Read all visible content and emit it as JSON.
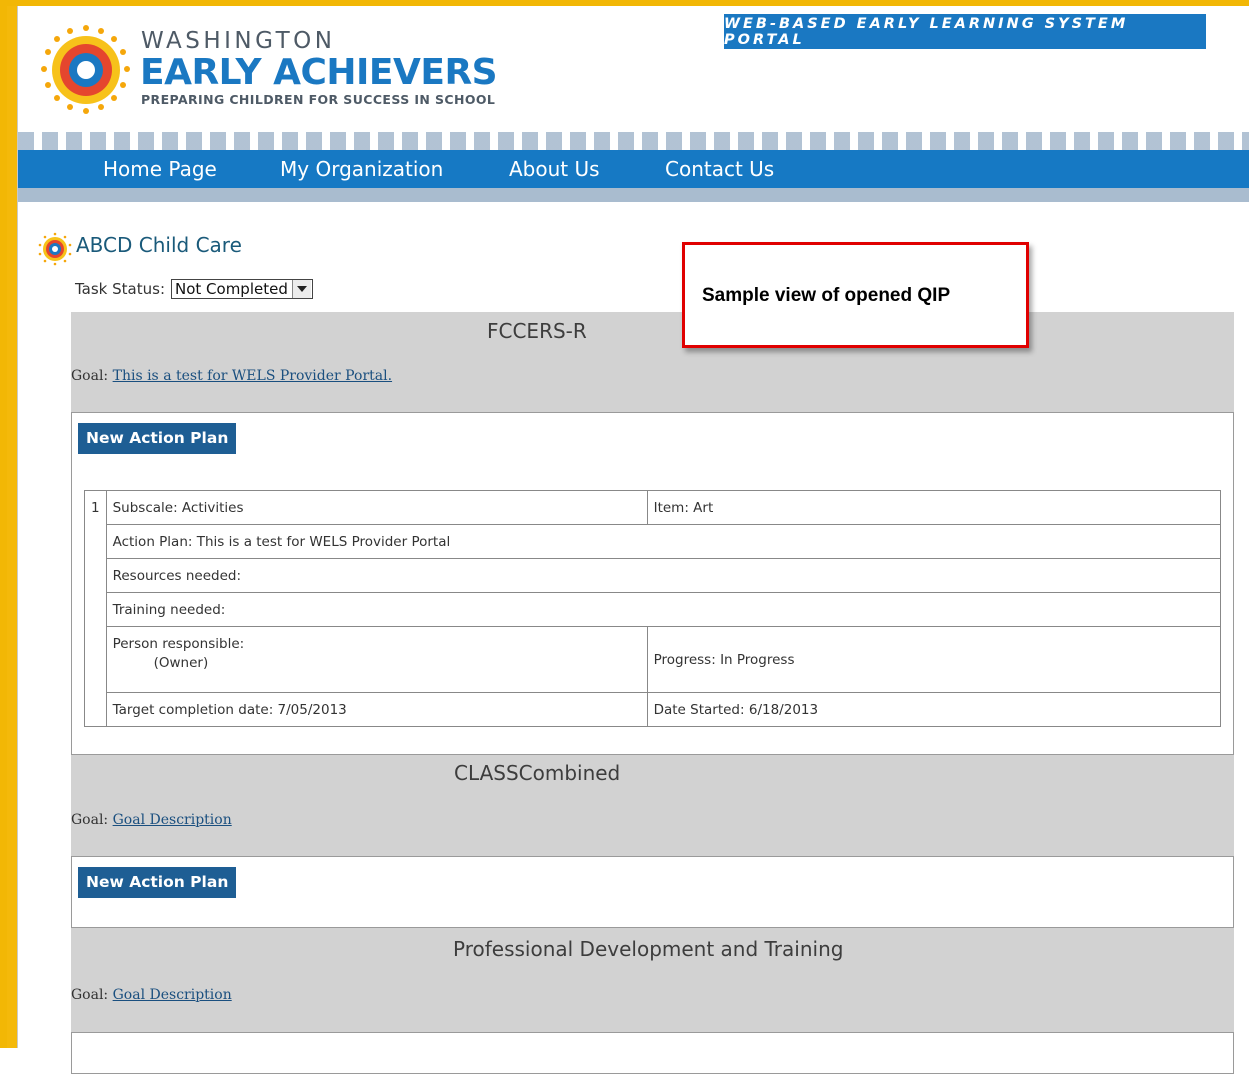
{
  "header": {
    "brand_line1": "WASHINGTON",
    "brand_line2": "EARLY ACHIEVERS",
    "brand_tagline": "PREPARING CHILDREN FOR SUCCESS IN SCHOOL",
    "portal_badge": "WEB-BASED EARLY LEARNING SYSTEM PORTAL"
  },
  "nav": {
    "items": [
      "Home Page",
      "My Organization",
      "About Us",
      "Contact Us"
    ]
  },
  "organization": {
    "name": "ABCD Child Care"
  },
  "task_status": {
    "label": "Task Status:",
    "selected": "Not Completed"
  },
  "callout": {
    "text": "Sample view of opened QIP"
  },
  "sections": [
    {
      "title": "FCCERS-R",
      "goal_label": "Goal:",
      "goal_link": "This is a test for WELS Provider Portal.",
      "button": "New Action Plan",
      "plan": {
        "number": "1",
        "subscale_label": "Subscale:",
        "subscale_value": "Activities",
        "item_label": "Item:",
        "item_value": "Art",
        "action_plan_label": "Action Plan:",
        "action_plan_value": "This is a test for WELS Provider Portal",
        "resources_label": "Resources needed:",
        "training_label": "Training needed:",
        "person_label": "Person responsible:",
        "person_value": "(Owner)",
        "progress_label": "Progress:",
        "progress_value": "In Progress",
        "target_label": "Target completion date:",
        "target_value": "7/05/2013",
        "started_label": "Date Started:",
        "started_value": "6/18/2013"
      }
    },
    {
      "title": "CLASSCombined",
      "goal_label": "Goal:",
      "goal_link": "Goal Description",
      "button": "New Action Plan"
    },
    {
      "title": "Professional Development and Training",
      "goal_label": "Goal:",
      "goal_link": "Goal Description"
    }
  ],
  "colors": {
    "frame_yellow": "#f2b705",
    "nav_blue": "#1679c4",
    "brand_blue": "#1a78c2",
    "button_blue": "#1e5e94",
    "section_gray": "#d2d2d2",
    "callout_red": "#e00000"
  }
}
